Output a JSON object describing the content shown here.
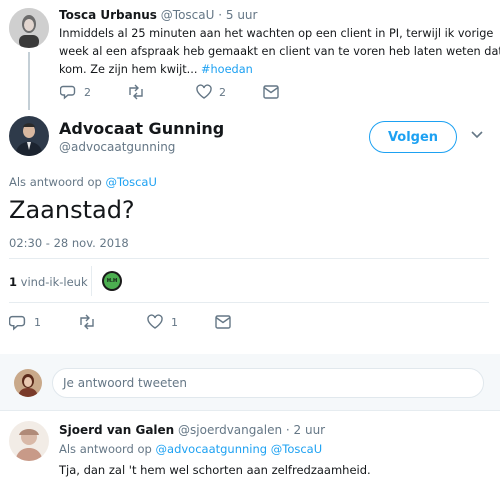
{
  "tweet1": {
    "author_name": "Tosca Urbanus",
    "handle": "@ToscaU",
    "time": "· 5 uur",
    "text_line1": "Inmiddels al 25 minuten aan het wachten op een client in PI, terwijl ik vorige",
    "text_line2": "week al een afspraak heb gemaakt en client van te voren heb laten weten dat ik",
    "text_line3": "kom. Ze zijn hem kwijt...",
    "hashtag": "#hoedan",
    "reply_count": "2",
    "like_count": "2"
  },
  "main_tweet": {
    "author_name": "Advocaat Gunning",
    "handle": "@advocaatgunning",
    "follow_label": "Volgen",
    "reply_prefix": "Als antwoord op",
    "reply_to": "@ToscaU",
    "text": "Zaanstad?",
    "timestamp": "02:30 - 28 nov. 2018",
    "likes_number": "1",
    "likes_label": "vind-ik-leuk",
    "liker_avatar_text": "H.H",
    "reply_count": "1",
    "like_count": "1"
  },
  "reply_box": {
    "placeholder": "Je antwoord tweeten"
  },
  "reply_tweet": {
    "author_name": "Sjoerd van Galen",
    "handle": "@sjoerdvangalen",
    "time": "· 2 uur",
    "reply_prefix": "Als antwoord op",
    "reply_to_1": "@advocaatgunning",
    "reply_to_2": "@ToscaU",
    "text": "Tja, dan zal 't hem wel schorten aan zelfredzaamheid."
  },
  "colors": {
    "accent": "#1da1f2",
    "muted": "#657786",
    "divider": "#e6ecf0"
  }
}
